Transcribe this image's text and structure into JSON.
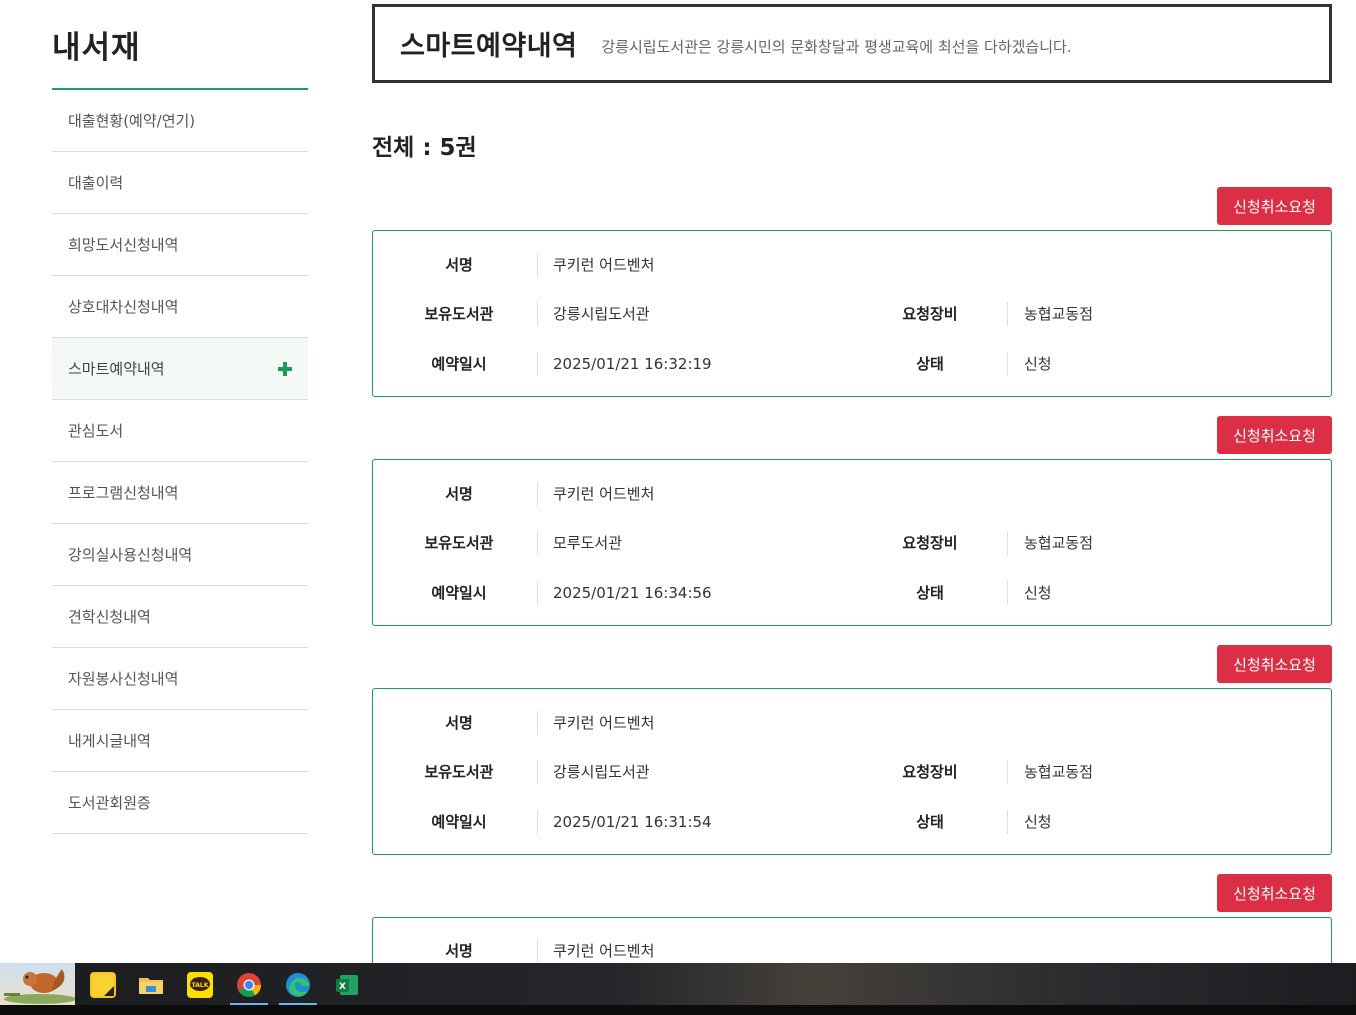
{
  "sidebar": {
    "title": "내서재",
    "items": [
      {
        "label": "대출현황(예약/연기)"
      },
      {
        "label": "대출이력"
      },
      {
        "label": "희망도서신청내역"
      },
      {
        "label": "상호대차신청내역"
      },
      {
        "label": "스마트예약내역",
        "active": true
      },
      {
        "label": "관심도서"
      },
      {
        "label": "프로그램신청내역"
      },
      {
        "label": "강의실사용신청내역"
      },
      {
        "label": "견학신청내역"
      },
      {
        "label": "자원봉사신청내역"
      },
      {
        "label": "내게시글내역"
      },
      {
        "label": "도서관회원증"
      }
    ]
  },
  "header": {
    "title": "스마트예약내역",
    "subtitle": "강릉시립도서관은 강릉시민의 문화창달과 평생교육에 최선을 다하겠습니다."
  },
  "total": "전체 : 5권",
  "labels": {
    "title": "서명",
    "library": "보유도서관",
    "device": "요청장비",
    "datetime": "예약일시",
    "status": "상태",
    "cancel": "신청취소요청"
  },
  "reservations": [
    {
      "title": "쿠키런 어드벤처",
      "library": "강릉시립도서관",
      "device": "농협교동점",
      "datetime": "2025/01/21 16:32:19",
      "status": "신청"
    },
    {
      "title": "쿠키런 어드벤처",
      "library": "모루도서관",
      "device": "농협교동점",
      "datetime": "2025/01/21 16:34:56",
      "status": "신청"
    },
    {
      "title": "쿠키런 어드벤처",
      "library": "강릉시립도서관",
      "device": "농협교동점",
      "datetime": "2025/01/21 16:31:54",
      "status": "신청"
    },
    {
      "title": "쿠키런 어드벤처"
    }
  ],
  "taskbar": {
    "apps": [
      "sticky-notes-icon",
      "file-explorer-icon",
      "kakaotalk-icon",
      "chrome-icon",
      "edge-icon",
      "excel-icon"
    ],
    "kakao_label": "TALK",
    "excel_label": "X"
  }
}
